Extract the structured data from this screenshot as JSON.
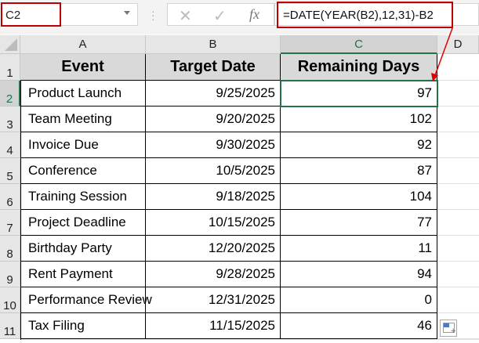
{
  "name_box": {
    "value": "C2"
  },
  "formula_bar": {
    "formula": "=DATE(YEAR(B2),12,31)-B2",
    "cancel_icon": "✕",
    "enter_icon": "✓",
    "fx_label": "fx"
  },
  "columns": [
    "A",
    "B",
    "C",
    "D"
  ],
  "row_numbers": [
    "1",
    "2",
    "3",
    "4",
    "5",
    "6",
    "7",
    "8",
    "9",
    "10",
    "11"
  ],
  "headers": [
    "Event",
    "Target Date",
    "Remaining Days"
  ],
  "rows": [
    [
      "Product Launch",
      "9/25/2025",
      "97"
    ],
    [
      "Team Meeting",
      "9/20/2025",
      "102"
    ],
    [
      "Invoice Due",
      "9/30/2025",
      "92"
    ],
    [
      "Conference",
      "10/5/2025",
      "87"
    ],
    [
      "Training Session",
      "9/18/2025",
      "104"
    ],
    [
      "Project Deadline",
      "10/15/2025",
      "77"
    ],
    [
      "Birthday Party",
      "12/20/2025",
      "11"
    ],
    [
      "Rent Payment",
      "9/28/2025",
      "94"
    ],
    [
      "Performance Review",
      "12/31/2025",
      "0"
    ],
    [
      "Tax Filing",
      "11/15/2025",
      "46"
    ]
  ],
  "colors": {
    "highlight": "#c00000",
    "selection": "#217346"
  }
}
